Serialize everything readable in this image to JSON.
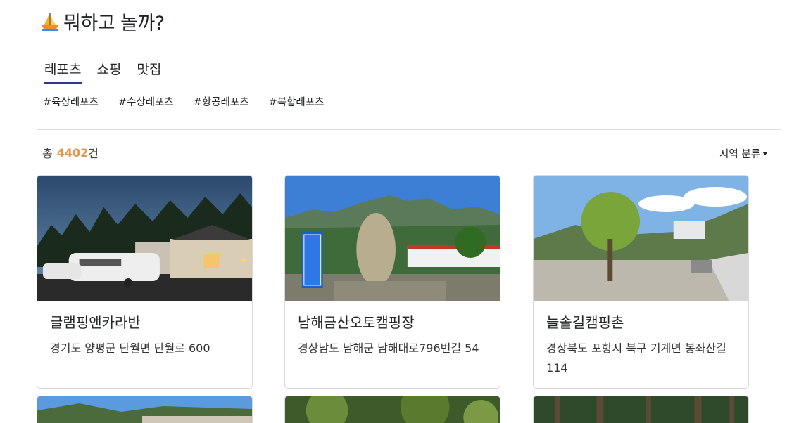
{
  "app": {
    "title": "뭐하고 놀까?",
    "logo_icon": "sailboat-icon"
  },
  "tabs": [
    {
      "label": "레포츠",
      "active": true
    },
    {
      "label": "쇼핑",
      "active": false
    },
    {
      "label": "맛집",
      "active": false
    }
  ],
  "hashtags": [
    "#육상레포츠",
    "#수상레포츠",
    "#항공레포츠",
    "#복합레포츠"
  ],
  "summary": {
    "prefix": "총",
    "count": "4402",
    "suffix": "건"
  },
  "filter": {
    "label": "지역 분류"
  },
  "cards": [
    {
      "title": "글램핑앤카라반",
      "address": "경기도 양평군 단월면 단월로 600"
    },
    {
      "title": "남해금산오토캠핑장",
      "address": "경상남도 남해군 남해대로796번길 54"
    },
    {
      "title": "늘솔길캠핑촌",
      "address": "경상북도 포항시 북구 기계면 봉좌산길 114"
    }
  ],
  "colors": {
    "accent": "#e8954b",
    "tab_underline": "#2d3a8c"
  }
}
